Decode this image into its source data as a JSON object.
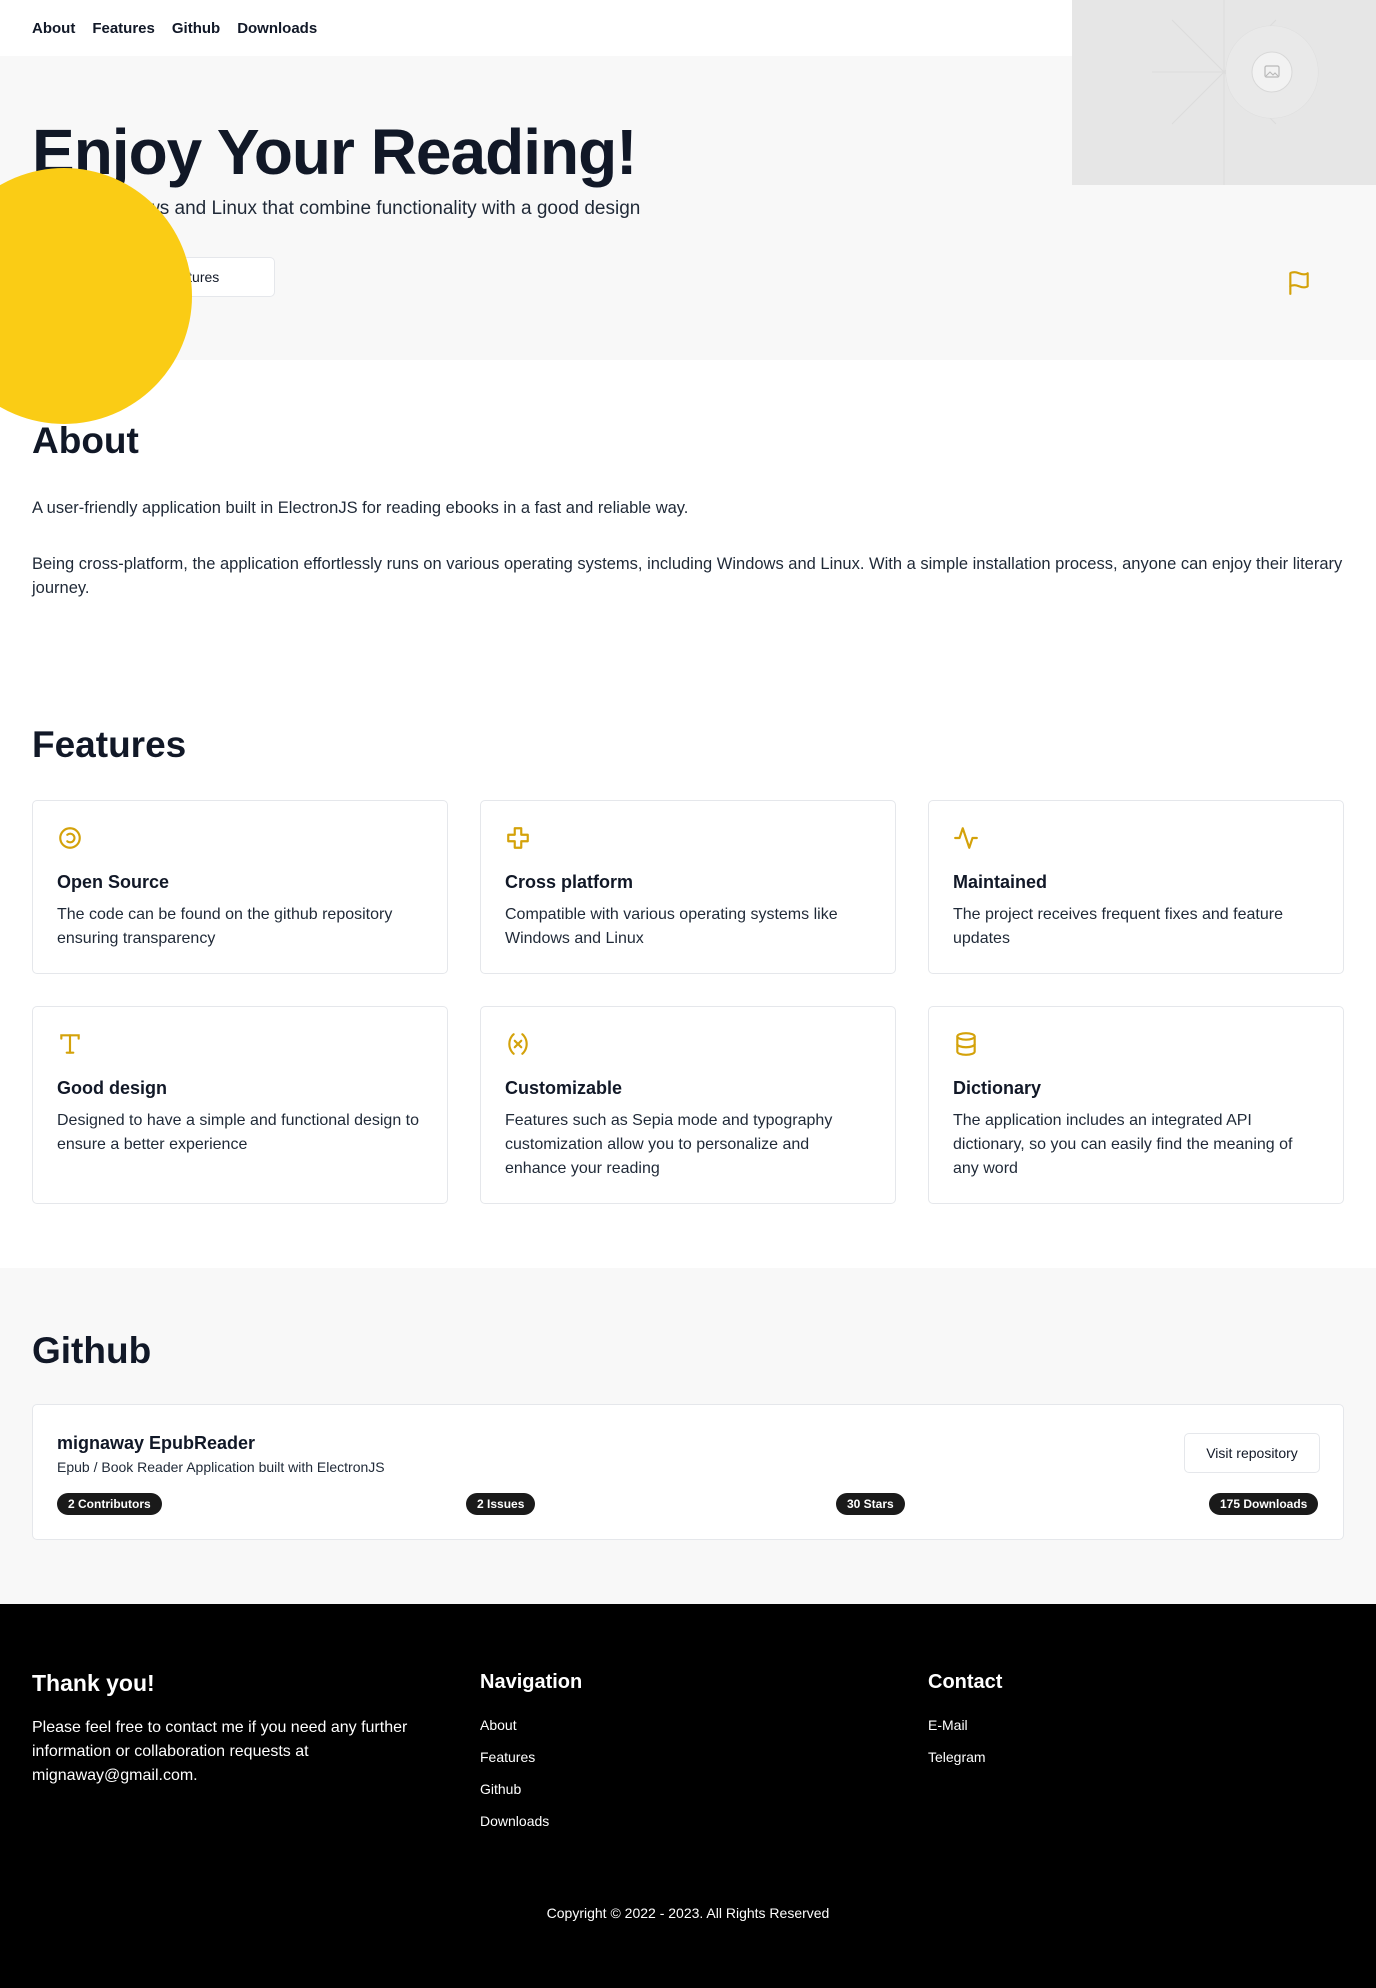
{
  "nav": {
    "items": [
      "About",
      "Features",
      "Github",
      "Downloads"
    ]
  },
  "hero": {
    "title": "Enjoy Your Reading!",
    "subtitle": "der for Windows and Linux that combine functionality with a good design",
    "button_label": "e features",
    "image_icon": "image-placeholder-icon",
    "flag_icon": "flag-icon"
  },
  "about": {
    "title": "About",
    "p1": "A user-friendly application built in ElectronJS for reading ebooks in a fast and reliable way.",
    "p2": "Being cross-platform, the application effortlessly runs on various operating systems, including Windows and Linux. With a simple installation process, anyone can enjoy their literary journey."
  },
  "features": {
    "title": "Features",
    "items": [
      {
        "title": "Open Source",
        "text": "The code can be found on the github repository ensuring transparency",
        "icon": "copyleft-icon"
      },
      {
        "title": "Cross platform",
        "text": "Compatible with various operating systems like Windows and Linux",
        "icon": "plus-icon"
      },
      {
        "title": "Maintained",
        "text": "The project receives frequent fixes and feature updates",
        "icon": "activity-icon"
      },
      {
        "title": "Good design",
        "text": "Designed to have a simple and functional design to ensure a better experience",
        "icon": "type-icon"
      },
      {
        "title": "Customizable",
        "text": "Features such as Sepia mode and typography customization allow you to personalize and enhance your reading",
        "icon": "variable-icon"
      },
      {
        "title": "Dictionary",
        "text": "The application includes an integrated API dictionary, so you can easily find the meaning of any word",
        "icon": "database-icon"
      }
    ]
  },
  "github": {
    "title": "Github",
    "repo_name": "mignaway EpubReader",
    "repo_desc": "Epub / Book Reader Application built with ElectronJS",
    "visit_label": "Visit repository",
    "badges": [
      "2 Contributors",
      "2 Issues",
      "30 Stars",
      "175 Downloads"
    ]
  },
  "footer": {
    "thanks_title": "Thank you!",
    "thanks_text": "Please feel free to contact me if you need any further information or collaboration requests at mignaway@gmail.com.",
    "nav_title": "Navigation",
    "nav_items": [
      "About",
      "Features",
      "Github",
      "Downloads"
    ],
    "contact_title": "Contact",
    "contact_items": [
      "E-Mail",
      "Telegram"
    ],
    "copyright": "Copyright © 2022 - 2023. All Rights Reserved"
  },
  "colors": {
    "accent": "#facc15",
    "icon": "#d4a20a",
    "dark": "#111827"
  }
}
